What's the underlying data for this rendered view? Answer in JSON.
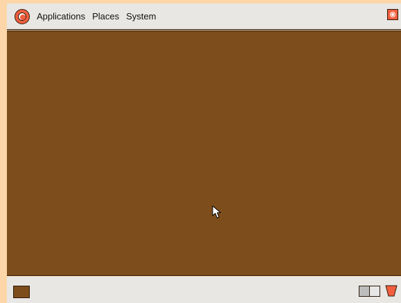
{
  "top_panel": {
    "menu": {
      "applications_label": "Applications",
      "places_label": "Places",
      "system_label": "System"
    },
    "icons": {
      "main_menu": "main-menu-icon",
      "close": "close-icon"
    }
  },
  "desktop": {
    "background_color": "#7d4d1c",
    "cursor": "mouse-pointer-icon"
  },
  "bottom_panel": {
    "show_desktop": "desktop-swatch",
    "workspaces": [
      "workspace-1",
      "workspace-2"
    ],
    "trash_icon": "trash-icon"
  },
  "colors": {
    "screen_bg": "#fcd6a8",
    "panel_bg": "#e9e7e4",
    "accent": "#f15f3f",
    "outline": "#2b1b0a"
  }
}
